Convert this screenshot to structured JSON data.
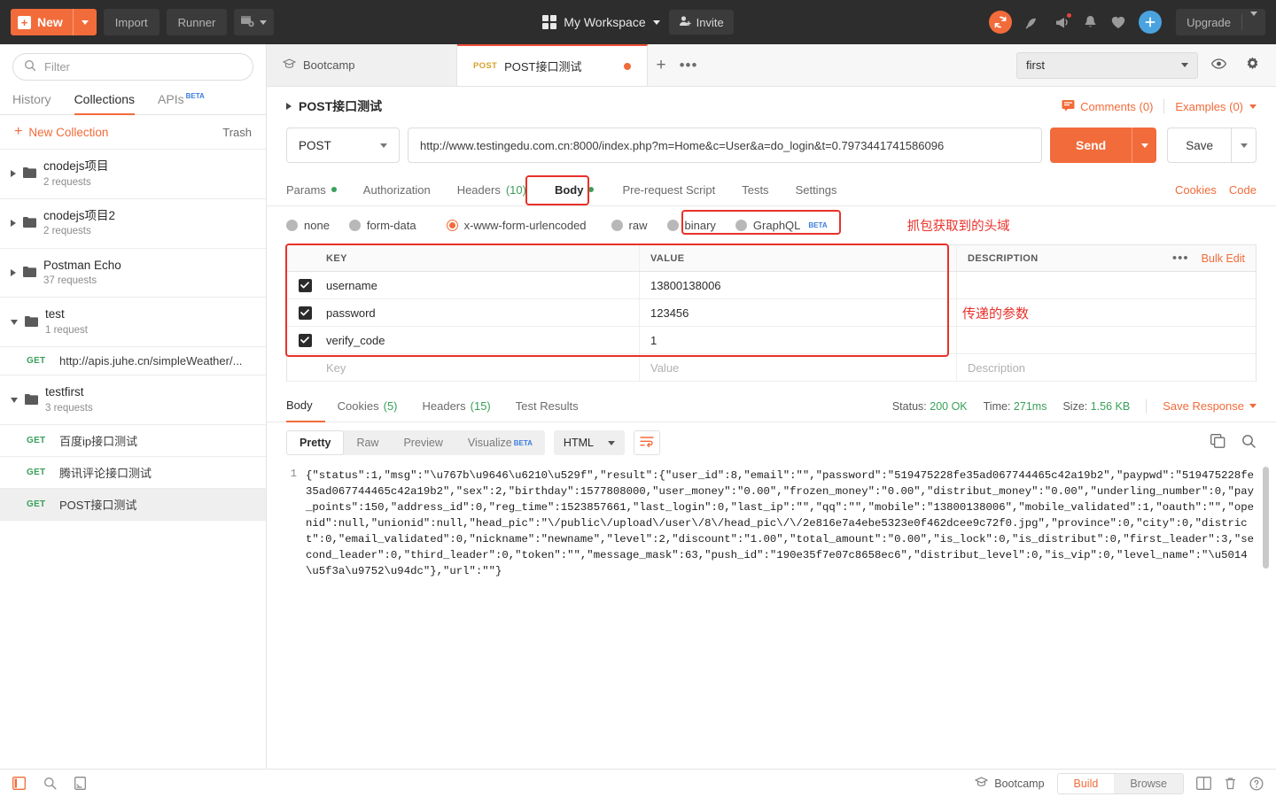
{
  "topbar": {
    "new_label": "New",
    "import_label": "Import",
    "runner_label": "Runner",
    "workspace_label": "My Workspace",
    "invite_label": "Invite",
    "upgrade_label": "Upgrade",
    "icons": [
      "sync-icon",
      "satellite-icon",
      "megaphone-icon",
      "bell-icon",
      "heart-icon",
      "plus-icon"
    ],
    "accent": "#f26b3a"
  },
  "sidebar": {
    "filter_placeholder": "Filter",
    "tabs": [
      {
        "label": "History",
        "active": false,
        "beta": ""
      },
      {
        "label": "Collections",
        "active": true,
        "beta": ""
      },
      {
        "label": "APIs",
        "active": false,
        "beta": "BETA"
      }
    ],
    "new_collection_label": "New Collection",
    "trash_label": "Trash",
    "items": [
      {
        "type": "folder",
        "name": "cnodejs项目",
        "sub": "2 requests",
        "expanded": false
      },
      {
        "type": "folder",
        "name": "cnodejs项目2",
        "sub": "2 requests",
        "expanded": false
      },
      {
        "type": "folder",
        "name": "Postman Echo",
        "sub": "37 requests",
        "expanded": false
      },
      {
        "type": "folder",
        "name": "test",
        "sub": "1 request",
        "expanded": true
      },
      {
        "type": "request",
        "method": "GET",
        "name": "http://apis.juhe.cn/simpleWeather/...",
        "selected": false
      },
      {
        "type": "folder",
        "name": "testfirst",
        "sub": "3 requests",
        "expanded": true
      },
      {
        "type": "request",
        "method": "GET",
        "name": "百度ip接口测试",
        "selected": false
      },
      {
        "type": "request",
        "method": "GET",
        "name": "腾讯评论接口测试",
        "selected": false
      },
      {
        "type": "request",
        "method": "GET",
        "name": "POST接口测试",
        "selected": true
      }
    ]
  },
  "tabstrip": {
    "tabs": [
      {
        "label": "Bootcamp",
        "method": "",
        "active": false,
        "unsaved": false
      },
      {
        "label": "POST接口测试",
        "method": "POST",
        "active": true,
        "unsaved": true
      }
    ],
    "add_label": "+",
    "more_label": "•••",
    "environment": "first"
  },
  "request": {
    "breadcrumb": "POST接口测试",
    "comments_label": "Comments (0)",
    "examples_label": "Examples (0)",
    "method": "POST",
    "url": "http://www.testingedu.com.cn:8000/index.php?m=Home&c=User&a=do_login&t=0.7973441741586096",
    "send_label": "Send",
    "save_label": "Save",
    "tabs": [
      {
        "label": "Params",
        "dot": true,
        "count": "",
        "active": false
      },
      {
        "label": "Authorization",
        "dot": false,
        "count": "",
        "active": false
      },
      {
        "label": "Headers",
        "dot": false,
        "count": "(10)",
        "active": false
      },
      {
        "label": "Body",
        "dot": true,
        "count": "",
        "active": true
      },
      {
        "label": "Pre-request Script",
        "dot": false,
        "count": "",
        "active": false
      },
      {
        "label": "Tests",
        "dot": false,
        "count": "",
        "active": false
      },
      {
        "label": "Settings",
        "dot": false,
        "count": "",
        "active": false
      }
    ],
    "cookies_label": "Cookies",
    "code_label": "Code",
    "body_types": [
      {
        "label": "none",
        "selected": false
      },
      {
        "label": "form-data",
        "selected": false
      },
      {
        "label": "x-www-form-urlencoded",
        "selected": true
      },
      {
        "label": "raw",
        "selected": false
      },
      {
        "label": "binary",
        "selected": false
      },
      {
        "label": "GraphQL",
        "selected": false,
        "beta": "BETA"
      }
    ],
    "annotation_headers": "抓包获取到的头域",
    "annotation_params": "传递的参数",
    "table": {
      "headers": [
        "KEY",
        "VALUE",
        "DESCRIPTION"
      ],
      "bulk_edit_label": "Bulk Edit",
      "rows": [
        {
          "checked": true,
          "key": "username",
          "value": "13800138006",
          "description": ""
        },
        {
          "checked": true,
          "key": "password",
          "value": "123456",
          "description": ""
        },
        {
          "checked": true,
          "key": "verify_code",
          "value": "1",
          "description": ""
        }
      ],
      "placeholder_row": {
        "key": "Key",
        "value": "Value",
        "description": "Description"
      }
    }
  },
  "response": {
    "tabs": [
      {
        "label": "Body",
        "count": "",
        "active": true
      },
      {
        "label": "Cookies",
        "count": "(5)",
        "active": false
      },
      {
        "label": "Headers",
        "count": "(15)",
        "active": false
      },
      {
        "label": "Test Results",
        "count": "",
        "active": false
      }
    ],
    "status_label": "Status:",
    "status_value": "200 OK",
    "time_label": "Time:",
    "time_value": "271ms",
    "size_label": "Size:",
    "size_value": "1.56 KB",
    "save_response_label": "Save Response",
    "viewer_modes": [
      {
        "label": "Pretty",
        "active": true
      },
      {
        "label": "Raw",
        "active": false
      },
      {
        "label": "Preview",
        "active": false
      },
      {
        "label": "Visualize",
        "active": false,
        "beta": "BETA"
      }
    ],
    "format": "HTML",
    "line_number": "1",
    "body": "{\"status\":1,\"msg\":\"\\u767b\\u9646\\u6210\\u529f\",\"result\":{\"user_id\":8,\"email\":\"\",\"password\":\"519475228fe35ad067744465c42a19b2\",\"paypwd\":\"519475228fe35ad067744465c42a19b2\",\"sex\":2,\"birthday\":1577808000,\"user_money\":\"0.00\",\"frozen_money\":\"0.00\",\"distribut_money\":\"0.00\",\"underling_number\":0,\"pay_points\":150,\"address_id\":0,\"reg_time\":1523857661,\"last_login\":0,\"last_ip\":\"\",\"qq\":\"\",\"mobile\":\"13800138006\",\"mobile_validated\":1,\"oauth\":\"\",\"openid\":null,\"unionid\":null,\"head_pic\":\"\\/public\\/upload\\/user\\/8\\/head_pic\\/\\/2e816e7a4ebe5323e0f462dcee9c72f0.jpg\",\"province\":0,\"city\":0,\"district\":0,\"email_validated\":0,\"nickname\":\"newname\",\"level\":2,\"discount\":\"1.00\",\"total_amount\":\"0.00\",\"is_lock\":0,\"is_distribut\":0,\"first_leader\":3,\"second_leader\":0,\"third_leader\":0,\"token\":\"\",\"message_mask\":63,\"push_id\":\"190e35f7e07c8658ec6\",\"distribut_level\":0,\"is_vip\":0,\"level_name\":\"\\u5014\\u5f3a\\u9752\\u94dc\"},\"url\":\"\"}"
  },
  "statusbar": {
    "bootcamp_label": "Bootcamp",
    "build_label": "Build",
    "browse_label": "Browse"
  }
}
